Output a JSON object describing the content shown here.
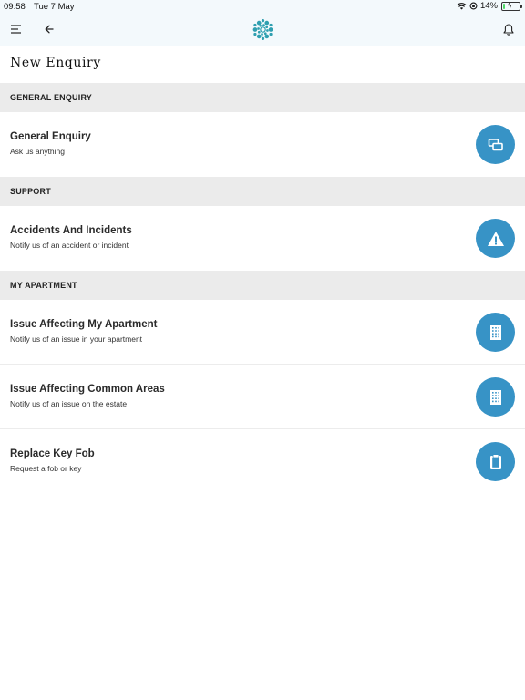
{
  "status": {
    "time": "09:58",
    "date": "Tue 7 May",
    "battery": "14%",
    "battery_level": 0.14
  },
  "header": {
    "menu_icon": "hamburger-icon",
    "back_icon": "arrow-left-icon",
    "logo_icon": "flower-logo-icon",
    "notifications_icon": "bell-icon"
  },
  "page": {
    "title": "New Enquiry"
  },
  "sections": [
    {
      "header": "GENERAL ENQUIRY",
      "items": [
        {
          "title": "General Enquiry",
          "subtitle": "Ask us anything",
          "icon": "chat-bubbles-icon"
        }
      ]
    },
    {
      "header": "SUPPORT",
      "items": [
        {
          "title": "Accidents And Incidents",
          "subtitle": "Notify us of an accident or incident",
          "icon": "warning-icon"
        }
      ]
    },
    {
      "header": "MY APARTMENT",
      "items": [
        {
          "title": "Issue Affecting My Apartment",
          "subtitle": "Notify us of an issue in your apartment",
          "icon": "building-icon"
        },
        {
          "title": "Issue Affecting Common Areas",
          "subtitle": "Notify us of an issue on the estate",
          "icon": "building-icon"
        },
        {
          "title": "Replace Key Fob",
          "subtitle": "Request a fob or key",
          "icon": "clipboard-icon"
        }
      ]
    }
  ],
  "colors": {
    "accent": "#3793c6",
    "logo": "#2f9fb0",
    "header_bg": "#f3f9fc",
    "section_bg": "#ebebeb"
  }
}
